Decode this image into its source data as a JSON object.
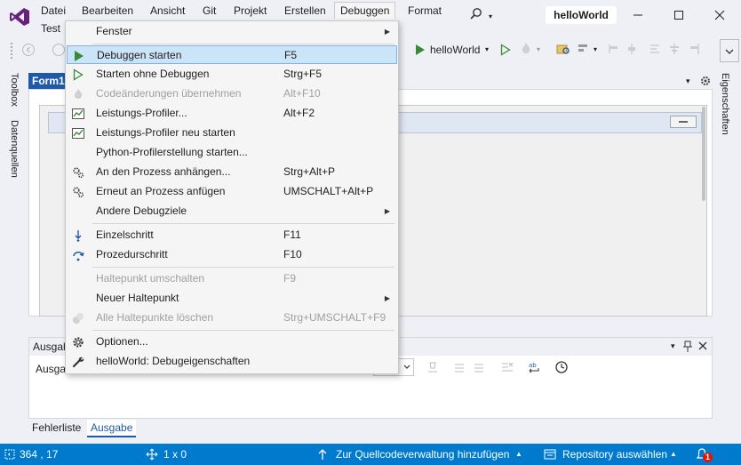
{
  "window": {
    "title": "helloWorld",
    "menubar": [
      "Datei",
      "Bearbeiten",
      "Ansicht",
      "Git",
      "Projekt",
      "Erstellen",
      "Debuggen",
      "Format",
      "Test"
    ],
    "active_menu": "Debuggen"
  },
  "toolbar": {
    "run_target": "helloWorld"
  },
  "left_tabs": [
    "Toolbox",
    "Datenquellen"
  ],
  "right_tabs": [
    "Eigenschaften"
  ],
  "document": {
    "tab_label": "Form1"
  },
  "debug_menu": {
    "items": [
      {
        "label": "Fenster",
        "shortcut": "",
        "submenu": true,
        "disabled": false,
        "icon": ""
      },
      {
        "label": "Debuggen starten",
        "shortcut": "F5",
        "submenu": false,
        "disabled": false,
        "icon": "play-icon",
        "highlighted": true
      },
      {
        "label": "Starten ohne Debuggen",
        "shortcut": "Strg+F5",
        "submenu": false,
        "disabled": false,
        "icon": "play-outline-icon"
      },
      {
        "label": "Codeänderungen übernehmen",
        "shortcut": "Alt+F10",
        "submenu": false,
        "disabled": true,
        "icon": "hot-reload-icon"
      },
      {
        "label": "Leistungs-Profiler...",
        "shortcut": "Alt+F2",
        "submenu": false,
        "disabled": false,
        "icon": "profiler-icon"
      },
      {
        "label": "Leistungs-Profiler neu starten",
        "shortcut": "",
        "submenu": false,
        "disabled": false,
        "icon": "profiler-icon"
      },
      {
        "label": "Python-Profilerstellung starten...",
        "shortcut": "",
        "submenu": false,
        "disabled": false,
        "icon": ""
      },
      {
        "label": "An den Prozess anhängen...",
        "shortcut": "Strg+Alt+P",
        "submenu": false,
        "disabled": false,
        "icon": "gears-icon"
      },
      {
        "label": "Erneut an Prozess anfügen",
        "shortcut": "UMSCHALT+Alt+P",
        "submenu": false,
        "disabled": false,
        "icon": "gears-icon"
      },
      {
        "label": "Andere Debugziele",
        "shortcut": "",
        "submenu": true,
        "disabled": false,
        "icon": ""
      },
      {
        "label": "Einzelschritt",
        "shortcut": "F11",
        "submenu": false,
        "disabled": false,
        "icon": "step-into-icon"
      },
      {
        "label": "Prozedurschritt",
        "shortcut": "F10",
        "submenu": false,
        "disabled": false,
        "icon": "step-over-icon"
      },
      {
        "label": "Haltepunkt umschalten",
        "shortcut": "F9",
        "submenu": false,
        "disabled": true,
        "icon": ""
      },
      {
        "label": "Neuer Haltepunkt",
        "shortcut": "",
        "submenu": true,
        "disabled": false,
        "icon": ""
      },
      {
        "label": "Alle Haltepunkte löschen",
        "shortcut": "Strg+UMSCHALT+F9",
        "submenu": false,
        "disabled": true,
        "icon": "delete-breakpoints-icon"
      },
      {
        "label": "Optionen...",
        "shortcut": "",
        "submenu": false,
        "disabled": false,
        "icon": "gear-icon"
      },
      {
        "label": "helloWorld: Debugeigenschaften",
        "shortcut": "",
        "submenu": false,
        "disabled": false,
        "icon": "wrench-icon"
      }
    ]
  },
  "output_panel": {
    "title": "Ausgabe",
    "source_label": "Ausgabe",
    "bottom_tabs": [
      "Fehlerliste",
      "Ausgabe"
    ],
    "active_bottom_tab": "Ausgabe"
  },
  "statusbar": {
    "cursor_pos": "364 , 17",
    "selection_size": "1 x 0",
    "source_control": "Zur Quellcodeverwaltung hinzufügen",
    "repository": "Repository auswählen",
    "notifications": "1",
    "bg_color": "#007acc"
  },
  "colors": {
    "accent": "#007acc",
    "vs_purple": "#68217a",
    "play_green": "#388a34",
    "menu_highlight": "#cce4f7"
  }
}
